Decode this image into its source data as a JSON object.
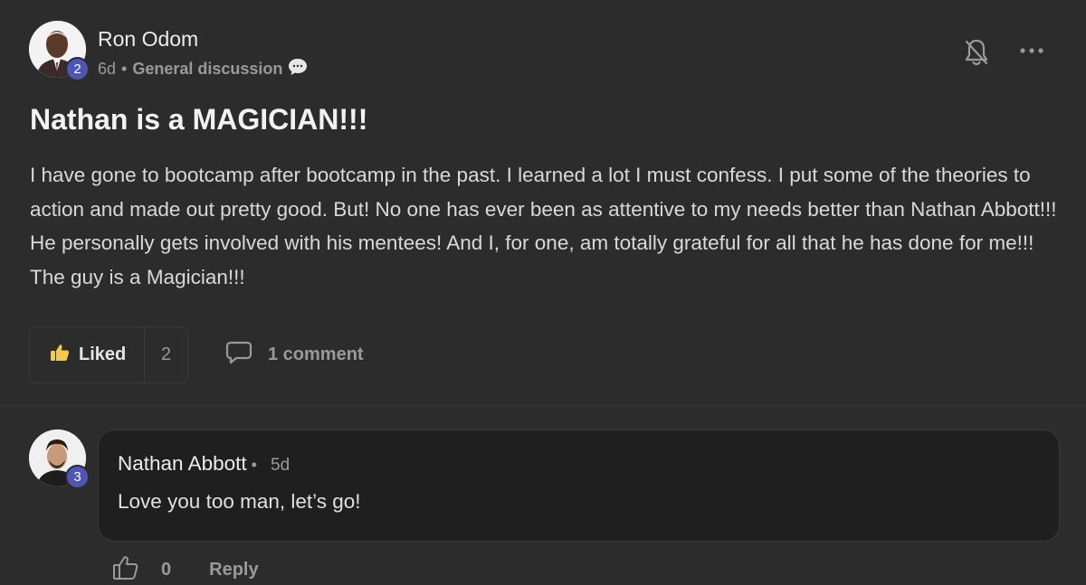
{
  "post": {
    "author": "Ron Odom",
    "author_level": "2",
    "time": "6d",
    "category": "General discussion",
    "title": "Nathan is a MAGICIAN!!!",
    "body": "I have gone to bootcamp after bootcamp in the past. I learned a lot I must confess. I put some of the theories to action and made out pretty good. But! No one has ever been as attentive to my needs better than Nathan Abbott!!! He personally gets involved with his mentees! And I, for one, am totally grateful for all that he has done for me!!! The guy is a Magician!!!",
    "like_label": "Liked",
    "like_count": "2",
    "comment_label": "1 comment"
  },
  "comment": {
    "author": "Nathan Abbott",
    "author_level": "3",
    "time": "5d",
    "text": "Love you too man, let’s go!",
    "like_count": "0",
    "reply_label": "Reply"
  },
  "icons": {
    "bell": "bell-off-icon",
    "more": "more-horizontal-icon",
    "thumbs_up_filled": "thumbs-up-filled-icon",
    "comment": "comment-icon",
    "thumbs_up_outline": "thumbs-up-outline-icon",
    "category_chat": "chat-bubble-icon"
  },
  "colors": {
    "background": "#2c2c2c",
    "comment_bg": "#1f1f1f",
    "level_badge": "#4e55b4",
    "like_accent": "#f2c94c"
  }
}
